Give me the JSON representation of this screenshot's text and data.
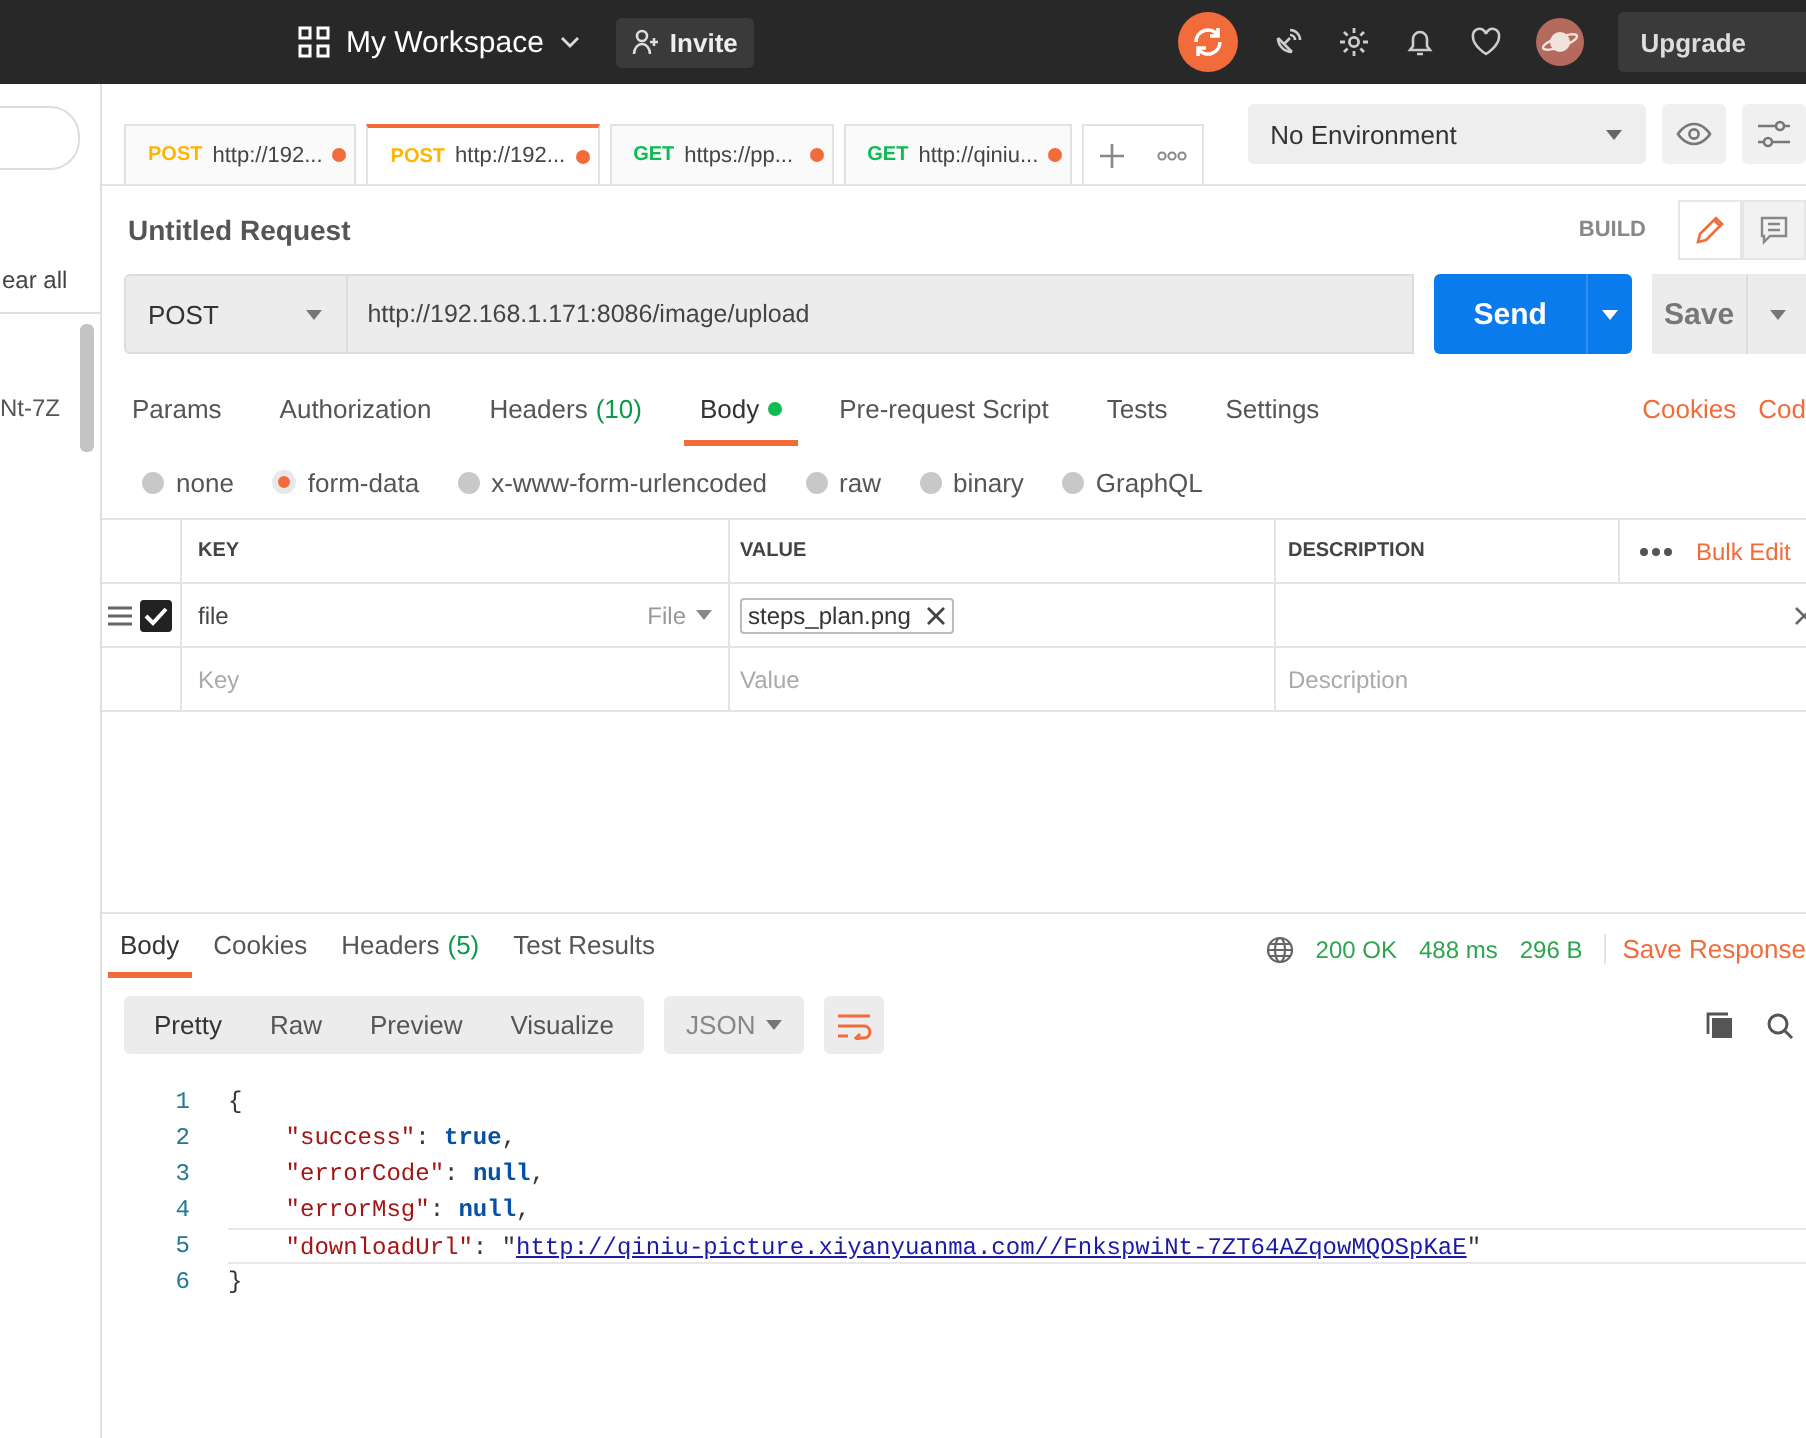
{
  "topbar": {
    "workspace": "My Workspace",
    "invite": "Invite",
    "upgrade": "Upgrade"
  },
  "sidebar": {
    "clear": "ear all",
    "item": "Nt-7Z"
  },
  "tabs": [
    {
      "method": "POST",
      "url": "http://192...",
      "color": "#ffb400",
      "selected": false
    },
    {
      "method": "POST",
      "url": "http://192...",
      "color": "#ffb400",
      "selected": true
    },
    {
      "method": "GET",
      "url": "https://pp...",
      "color": "#0cbb52",
      "selected": false
    },
    {
      "method": "GET",
      "url": "http://qiniu...",
      "color": "#0cbb52",
      "selected": false
    }
  ],
  "environment": "No Environment",
  "request": {
    "title": "Untitled Request",
    "mode": "BUILD",
    "method": "POST",
    "url": "http://192.168.1.171:8086/image/upload",
    "send": "Send",
    "save": "Save"
  },
  "request_tabs": [
    {
      "label": "Params",
      "selected": false
    },
    {
      "label": "Authorization",
      "selected": false
    },
    {
      "label": "Headers",
      "count": "(10)",
      "selected": false
    },
    {
      "label": "Body",
      "dot": true,
      "selected": true
    },
    {
      "label": "Pre-request Script",
      "selected": false
    },
    {
      "label": "Tests",
      "selected": false
    },
    {
      "label": "Settings",
      "selected": false
    }
  ],
  "request_links": [
    "Cookies",
    "Cod"
  ],
  "body_types": [
    {
      "label": "none",
      "selected": false
    },
    {
      "label": "form-data",
      "selected": true
    },
    {
      "label": "x-www-form-urlencoded",
      "selected": false
    },
    {
      "label": "raw",
      "selected": false
    },
    {
      "label": "binary",
      "selected": false
    },
    {
      "label": "GraphQL",
      "selected": false
    }
  ],
  "table": {
    "columns": [
      "KEY",
      "VALUE",
      "DESCRIPTION"
    ],
    "bulk_edit": "Bulk Edit",
    "rows": [
      {
        "checked": true,
        "key": "file",
        "type": "File",
        "file": "steps_plan.png"
      }
    ],
    "placeholders": {
      "key": "Key",
      "value": "Value",
      "description": "Description"
    }
  },
  "response_tabs": [
    {
      "label": "Body",
      "selected": true
    },
    {
      "label": "Cookies",
      "selected": false
    },
    {
      "label": "Headers",
      "count": "(5)",
      "selected": false
    },
    {
      "label": "Test Results",
      "selected": false
    }
  ],
  "response_status": {
    "status": "200 OK",
    "time": "488 ms",
    "size": "296 B",
    "save": "Save Response"
  },
  "views": [
    {
      "label": "Pretty",
      "selected": true
    },
    {
      "label": "Raw",
      "selected": false
    },
    {
      "label": "Preview",
      "selected": false
    },
    {
      "label": "Visualize",
      "selected": false
    }
  ],
  "format": "JSON",
  "code_lines": [
    {
      "number": "1",
      "current": false,
      "tokens": [
        {
          "kind": "punct",
          "text": "{"
        }
      ]
    },
    {
      "number": "2",
      "current": false,
      "tokens": [
        {
          "kind": "key",
          "text": "    \"success\""
        },
        {
          "kind": "punct",
          "text": ": "
        },
        {
          "kind": "literal",
          "text": "true"
        },
        {
          "kind": "punct",
          "text": ","
        }
      ]
    },
    {
      "number": "3",
      "current": false,
      "tokens": [
        {
          "kind": "key",
          "text": "    \"errorCode\""
        },
        {
          "kind": "punct",
          "text": ": "
        },
        {
          "kind": "literal",
          "text": "null"
        },
        {
          "kind": "punct",
          "text": ","
        }
      ]
    },
    {
      "number": "4",
      "current": false,
      "tokens": [
        {
          "kind": "key",
          "text": "    \"errorMsg\""
        },
        {
          "kind": "punct",
          "text": ": "
        },
        {
          "kind": "literal",
          "text": "null"
        },
        {
          "kind": "punct",
          "text": ","
        }
      ]
    },
    {
      "number": "5",
      "current": true,
      "tokens": [
        {
          "kind": "key",
          "text": "    \"downloadUrl\""
        },
        {
          "kind": "punct",
          "text": ": \""
        },
        {
          "kind": "link",
          "text": "http://qiniu-picture.xiyanyuanma.com//FnkspwiNt-7ZT64AZqowMQOSpKaE"
        },
        {
          "kind": "punct",
          "text": "\""
        }
      ]
    },
    {
      "number": "6",
      "current": false,
      "tokens": [
        {
          "kind": "punct",
          "text": "}"
        }
      ]
    }
  ]
}
